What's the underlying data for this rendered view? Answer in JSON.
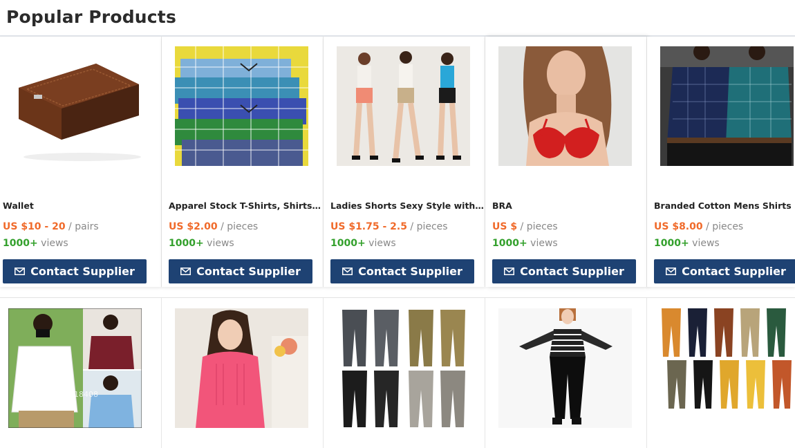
{
  "section": {
    "title": "Popular Products"
  },
  "row1": [
    {
      "name": "Wallet",
      "price": "US $10 - 20",
      "unit": "/ pairs",
      "views_count": "1000+",
      "views_label": "views",
      "button": "Contact Supplier",
      "image": "wallet-image"
    },
    {
      "name": "Apparel Stock T-Shirts, Shirts,...",
      "price": "US $2.00",
      "unit": "/ pieces",
      "views_count": "1000+",
      "views_label": "views",
      "button": "Contact Supplier",
      "image": "plaid-shirts-image"
    },
    {
      "name": "Ladies Shorts Sexy Style with ...",
      "price": "US $1.75 - 2.5",
      "unit": "/ pieces",
      "views_count": "1000+",
      "views_label": "views",
      "button": "Contact Supplier",
      "image": "ladies-shorts-image"
    },
    {
      "name": "BRA",
      "price": "US $",
      "unit": "/ pieces",
      "views_count": "1000+",
      "views_label": "views",
      "button": "Contact Supplier",
      "image": "bra-image"
    },
    {
      "name": "Branded Cotton Mens Shirts O...",
      "price": "US $8.00",
      "unit": "/ pieces",
      "views_count": "1000+",
      "views_label": "views",
      "button": "Contact Supplier",
      "image": "mens-shirts-image"
    }
  ],
  "row2": [
    {
      "image": "mens-casual-shirts-image",
      "watermark": "Store No.: 818408"
    },
    {
      "image": "pink-blouse-image"
    },
    {
      "image": "trousers-grid-image"
    },
    {
      "image": "striped-top-black-jeans-image"
    },
    {
      "image": "colored-chinos-image"
    }
  ],
  "colors": {
    "accent_button": "#1e4273",
    "price": "#f06a2a",
    "views_count": "#33a02c",
    "muted_text": "#888888"
  },
  "icons": {
    "button_icon": "envelope-icon"
  }
}
